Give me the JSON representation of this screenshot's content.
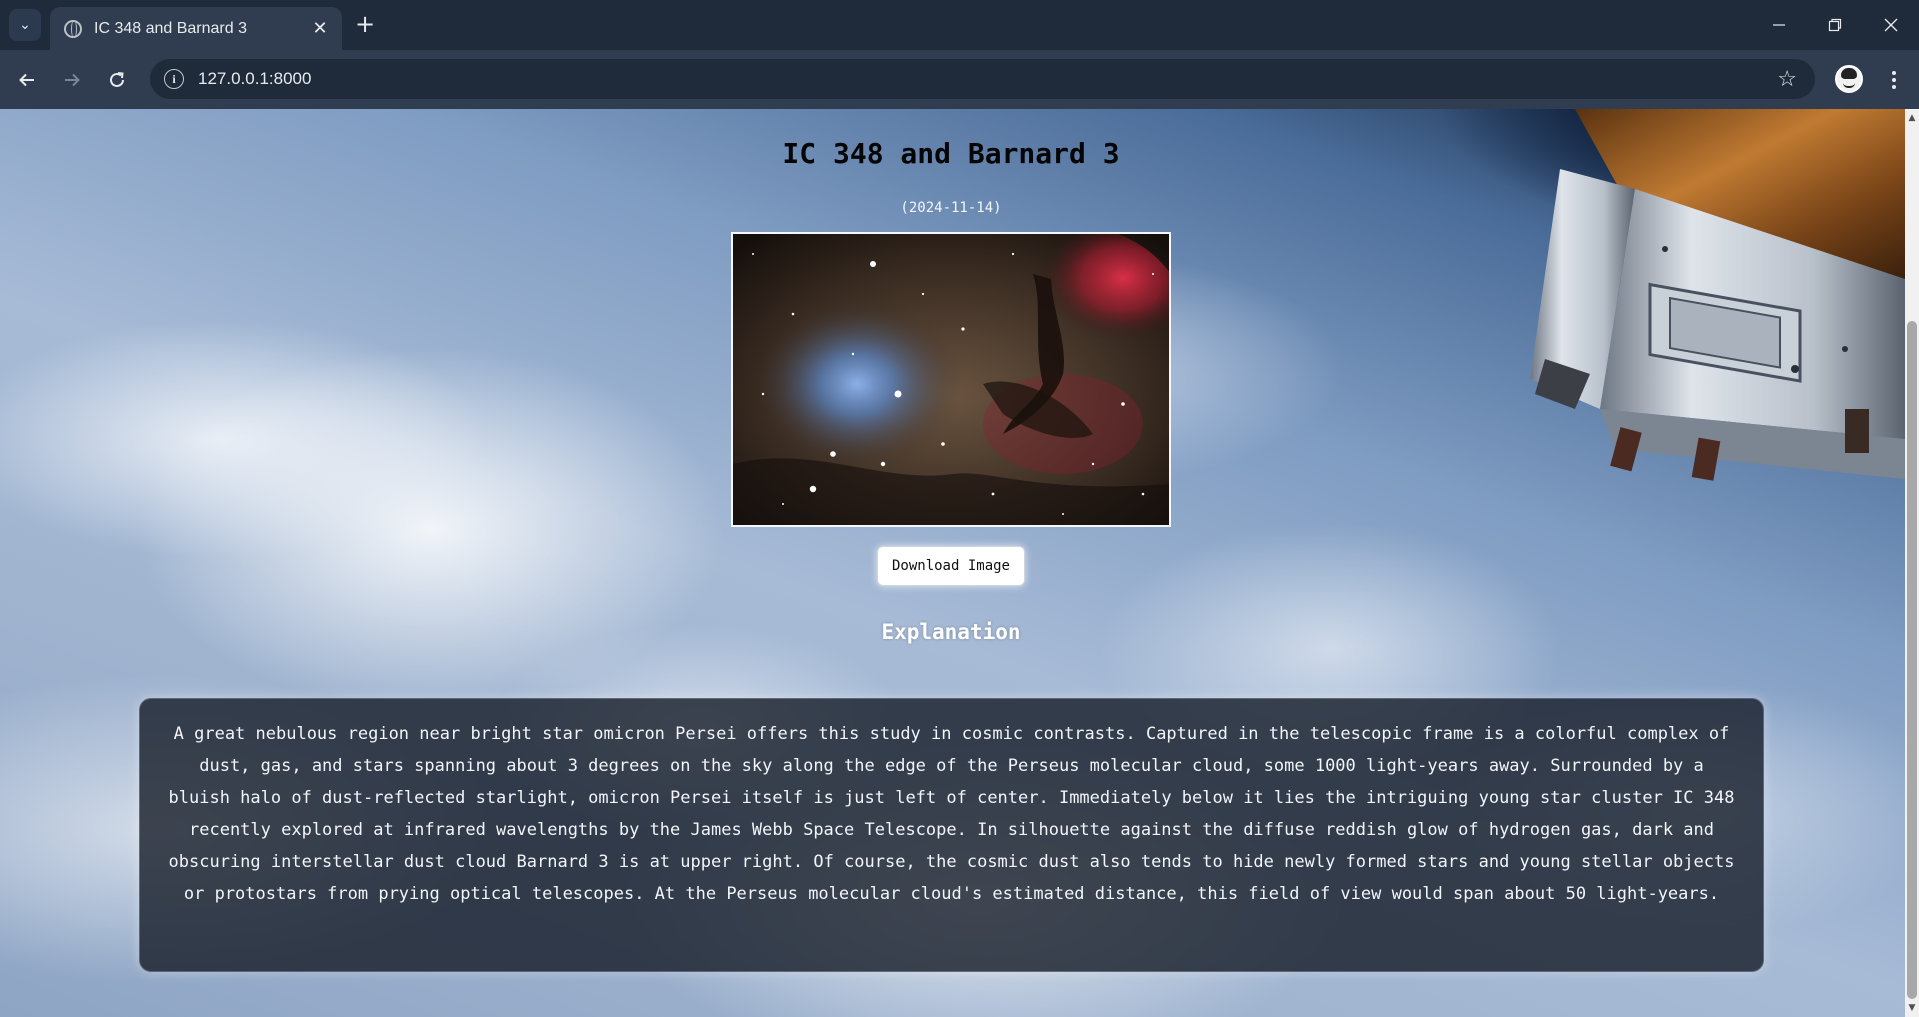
{
  "browser": {
    "tab_title": "IC 348 and Barnard 3",
    "new_tab_label": "+",
    "url": "127.0.0.1:8000"
  },
  "page": {
    "title": "IC 348 and Barnard 3",
    "date": "(2024-11-14)",
    "download_label": "Download Image",
    "explanation_heading": "Explanation",
    "explanation": "A great nebulous region near bright star omicron Persei offers this study in cosmic contrasts. Captured in the telescopic frame is a colorful complex of dust, gas, and stars spanning about 3 degrees on the sky along the edge of the Perseus molecular cloud, some 1000 light-years away. Surrounded by a bluish halo of dust-reflected starlight, omicron Persei itself is just left of center. Immediately below it lies the intriguing young star cluster IC 348 recently explored at infrared wavelengths by the James Webb Space Telescope. In silhouette against the diffuse reddish glow of hydrogen gas, dark and obscuring interstellar dust cloud Barnard 3 is at upper right. Of course, the cosmic dust also tends to hide newly formed stars and young stellar objects or protostars from prying optical telescopes. At the Perseus molecular cloud's estimated distance, this field of view would span about 50 light-years."
  },
  "colors": {
    "chrome_dark": "#1f2a3a",
    "chrome_toolbar": "#303c50",
    "panel_bg": "#121824",
    "text_light": "#f2f4f8"
  },
  "icons": {
    "tab_search": "chevron-down-icon",
    "favicon": "globe-icon",
    "tab_close": "close-icon",
    "minimize": "minimize-icon",
    "restore": "restore-icon",
    "window_close": "close-icon",
    "back": "arrow-left-icon",
    "forward": "arrow-right-icon",
    "reload": "reload-icon",
    "site_info": "info-icon",
    "bookmark": "star-icon",
    "menu": "kebab-menu-icon"
  }
}
